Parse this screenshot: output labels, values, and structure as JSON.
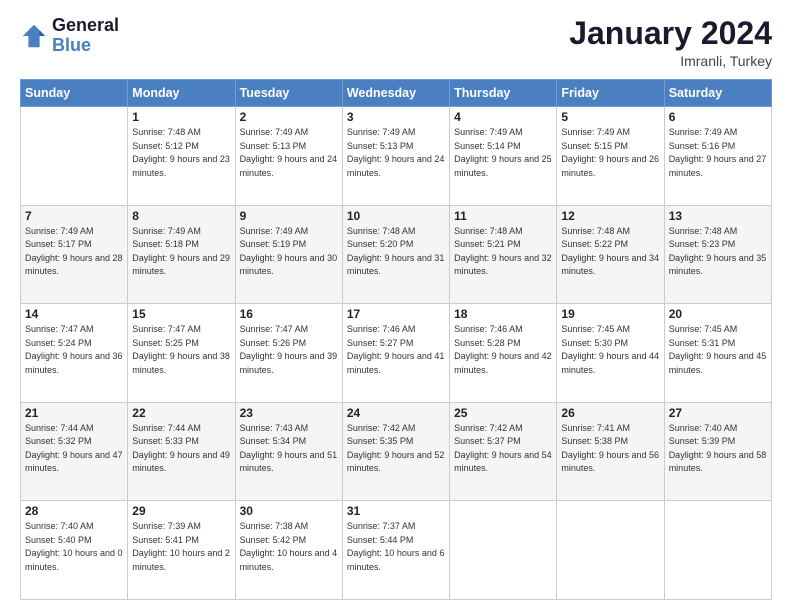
{
  "header": {
    "logo_line1": "General",
    "logo_line2": "Blue",
    "month_title": "January 2024",
    "subtitle": "Imranli, Turkey"
  },
  "weekdays": [
    "Sunday",
    "Monday",
    "Tuesday",
    "Wednesday",
    "Thursday",
    "Friday",
    "Saturday"
  ],
  "weeks": [
    [
      {
        "day": "",
        "sunrise": "",
        "sunset": "",
        "daylight": ""
      },
      {
        "day": "1",
        "sunrise": "Sunrise: 7:48 AM",
        "sunset": "Sunset: 5:12 PM",
        "daylight": "Daylight: 9 hours and 23 minutes."
      },
      {
        "day": "2",
        "sunrise": "Sunrise: 7:49 AM",
        "sunset": "Sunset: 5:13 PM",
        "daylight": "Daylight: 9 hours and 24 minutes."
      },
      {
        "day": "3",
        "sunrise": "Sunrise: 7:49 AM",
        "sunset": "Sunset: 5:13 PM",
        "daylight": "Daylight: 9 hours and 24 minutes."
      },
      {
        "day": "4",
        "sunrise": "Sunrise: 7:49 AM",
        "sunset": "Sunset: 5:14 PM",
        "daylight": "Daylight: 9 hours and 25 minutes."
      },
      {
        "day": "5",
        "sunrise": "Sunrise: 7:49 AM",
        "sunset": "Sunset: 5:15 PM",
        "daylight": "Daylight: 9 hours and 26 minutes."
      },
      {
        "day": "6",
        "sunrise": "Sunrise: 7:49 AM",
        "sunset": "Sunset: 5:16 PM",
        "daylight": "Daylight: 9 hours and 27 minutes."
      }
    ],
    [
      {
        "day": "7",
        "sunrise": "Sunrise: 7:49 AM",
        "sunset": "Sunset: 5:17 PM",
        "daylight": "Daylight: 9 hours and 28 minutes."
      },
      {
        "day": "8",
        "sunrise": "Sunrise: 7:49 AM",
        "sunset": "Sunset: 5:18 PM",
        "daylight": "Daylight: 9 hours and 29 minutes."
      },
      {
        "day": "9",
        "sunrise": "Sunrise: 7:49 AM",
        "sunset": "Sunset: 5:19 PM",
        "daylight": "Daylight: 9 hours and 30 minutes."
      },
      {
        "day": "10",
        "sunrise": "Sunrise: 7:48 AM",
        "sunset": "Sunset: 5:20 PM",
        "daylight": "Daylight: 9 hours and 31 minutes."
      },
      {
        "day": "11",
        "sunrise": "Sunrise: 7:48 AM",
        "sunset": "Sunset: 5:21 PM",
        "daylight": "Daylight: 9 hours and 32 minutes."
      },
      {
        "day": "12",
        "sunrise": "Sunrise: 7:48 AM",
        "sunset": "Sunset: 5:22 PM",
        "daylight": "Daylight: 9 hours and 34 minutes."
      },
      {
        "day": "13",
        "sunrise": "Sunrise: 7:48 AM",
        "sunset": "Sunset: 5:23 PM",
        "daylight": "Daylight: 9 hours and 35 minutes."
      }
    ],
    [
      {
        "day": "14",
        "sunrise": "Sunrise: 7:47 AM",
        "sunset": "Sunset: 5:24 PM",
        "daylight": "Daylight: 9 hours and 36 minutes."
      },
      {
        "day": "15",
        "sunrise": "Sunrise: 7:47 AM",
        "sunset": "Sunset: 5:25 PM",
        "daylight": "Daylight: 9 hours and 38 minutes."
      },
      {
        "day": "16",
        "sunrise": "Sunrise: 7:47 AM",
        "sunset": "Sunset: 5:26 PM",
        "daylight": "Daylight: 9 hours and 39 minutes."
      },
      {
        "day": "17",
        "sunrise": "Sunrise: 7:46 AM",
        "sunset": "Sunset: 5:27 PM",
        "daylight": "Daylight: 9 hours and 41 minutes."
      },
      {
        "day": "18",
        "sunrise": "Sunrise: 7:46 AM",
        "sunset": "Sunset: 5:28 PM",
        "daylight": "Daylight: 9 hours and 42 minutes."
      },
      {
        "day": "19",
        "sunrise": "Sunrise: 7:45 AM",
        "sunset": "Sunset: 5:30 PM",
        "daylight": "Daylight: 9 hours and 44 minutes."
      },
      {
        "day": "20",
        "sunrise": "Sunrise: 7:45 AM",
        "sunset": "Sunset: 5:31 PM",
        "daylight": "Daylight: 9 hours and 45 minutes."
      }
    ],
    [
      {
        "day": "21",
        "sunrise": "Sunrise: 7:44 AM",
        "sunset": "Sunset: 5:32 PM",
        "daylight": "Daylight: 9 hours and 47 minutes."
      },
      {
        "day": "22",
        "sunrise": "Sunrise: 7:44 AM",
        "sunset": "Sunset: 5:33 PM",
        "daylight": "Daylight: 9 hours and 49 minutes."
      },
      {
        "day": "23",
        "sunrise": "Sunrise: 7:43 AM",
        "sunset": "Sunset: 5:34 PM",
        "daylight": "Daylight: 9 hours and 51 minutes."
      },
      {
        "day": "24",
        "sunrise": "Sunrise: 7:42 AM",
        "sunset": "Sunset: 5:35 PM",
        "daylight": "Daylight: 9 hours and 52 minutes."
      },
      {
        "day": "25",
        "sunrise": "Sunrise: 7:42 AM",
        "sunset": "Sunset: 5:37 PM",
        "daylight": "Daylight: 9 hours and 54 minutes."
      },
      {
        "day": "26",
        "sunrise": "Sunrise: 7:41 AM",
        "sunset": "Sunset: 5:38 PM",
        "daylight": "Daylight: 9 hours and 56 minutes."
      },
      {
        "day": "27",
        "sunrise": "Sunrise: 7:40 AM",
        "sunset": "Sunset: 5:39 PM",
        "daylight": "Daylight: 9 hours and 58 minutes."
      }
    ],
    [
      {
        "day": "28",
        "sunrise": "Sunrise: 7:40 AM",
        "sunset": "Sunset: 5:40 PM",
        "daylight": "Daylight: 10 hours and 0 minutes."
      },
      {
        "day": "29",
        "sunrise": "Sunrise: 7:39 AM",
        "sunset": "Sunset: 5:41 PM",
        "daylight": "Daylight: 10 hours and 2 minutes."
      },
      {
        "day": "30",
        "sunrise": "Sunrise: 7:38 AM",
        "sunset": "Sunset: 5:42 PM",
        "daylight": "Daylight: 10 hours and 4 minutes."
      },
      {
        "day": "31",
        "sunrise": "Sunrise: 7:37 AM",
        "sunset": "Sunset: 5:44 PM",
        "daylight": "Daylight: 10 hours and 6 minutes."
      },
      {
        "day": "",
        "sunrise": "",
        "sunset": "",
        "daylight": ""
      },
      {
        "day": "",
        "sunrise": "",
        "sunset": "",
        "daylight": ""
      },
      {
        "day": "",
        "sunrise": "",
        "sunset": "",
        "daylight": ""
      }
    ]
  ]
}
